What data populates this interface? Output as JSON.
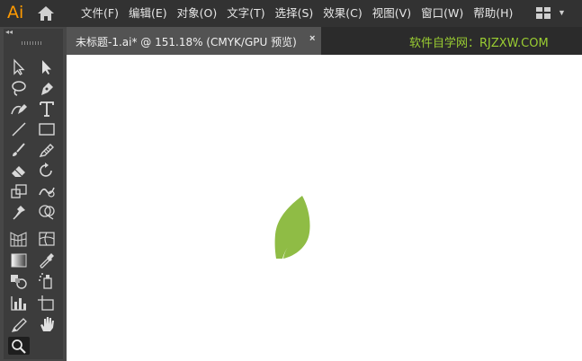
{
  "app": {
    "logo": "Ai"
  },
  "menu": [
    "文件(F)",
    "编辑(E)",
    "对象(O)",
    "文字(T)",
    "选择(S)",
    "效果(C)",
    "视图(V)",
    "窗口(W)",
    "帮助(H)"
  ],
  "document_tab": {
    "title": "未标题-1.ai* @ 151.18% (CMYK/GPU 预览)",
    "close": "×"
  },
  "watermark": "软件自学网：RJZXW.COM",
  "toolbar": {
    "collapse": "◂◂"
  },
  "colors": {
    "menubar": "#323232",
    "toolbar": "#3c3c3c",
    "leaf": "#8fbc45",
    "watermark": "#9acd32",
    "logo": "#ff9a00"
  }
}
